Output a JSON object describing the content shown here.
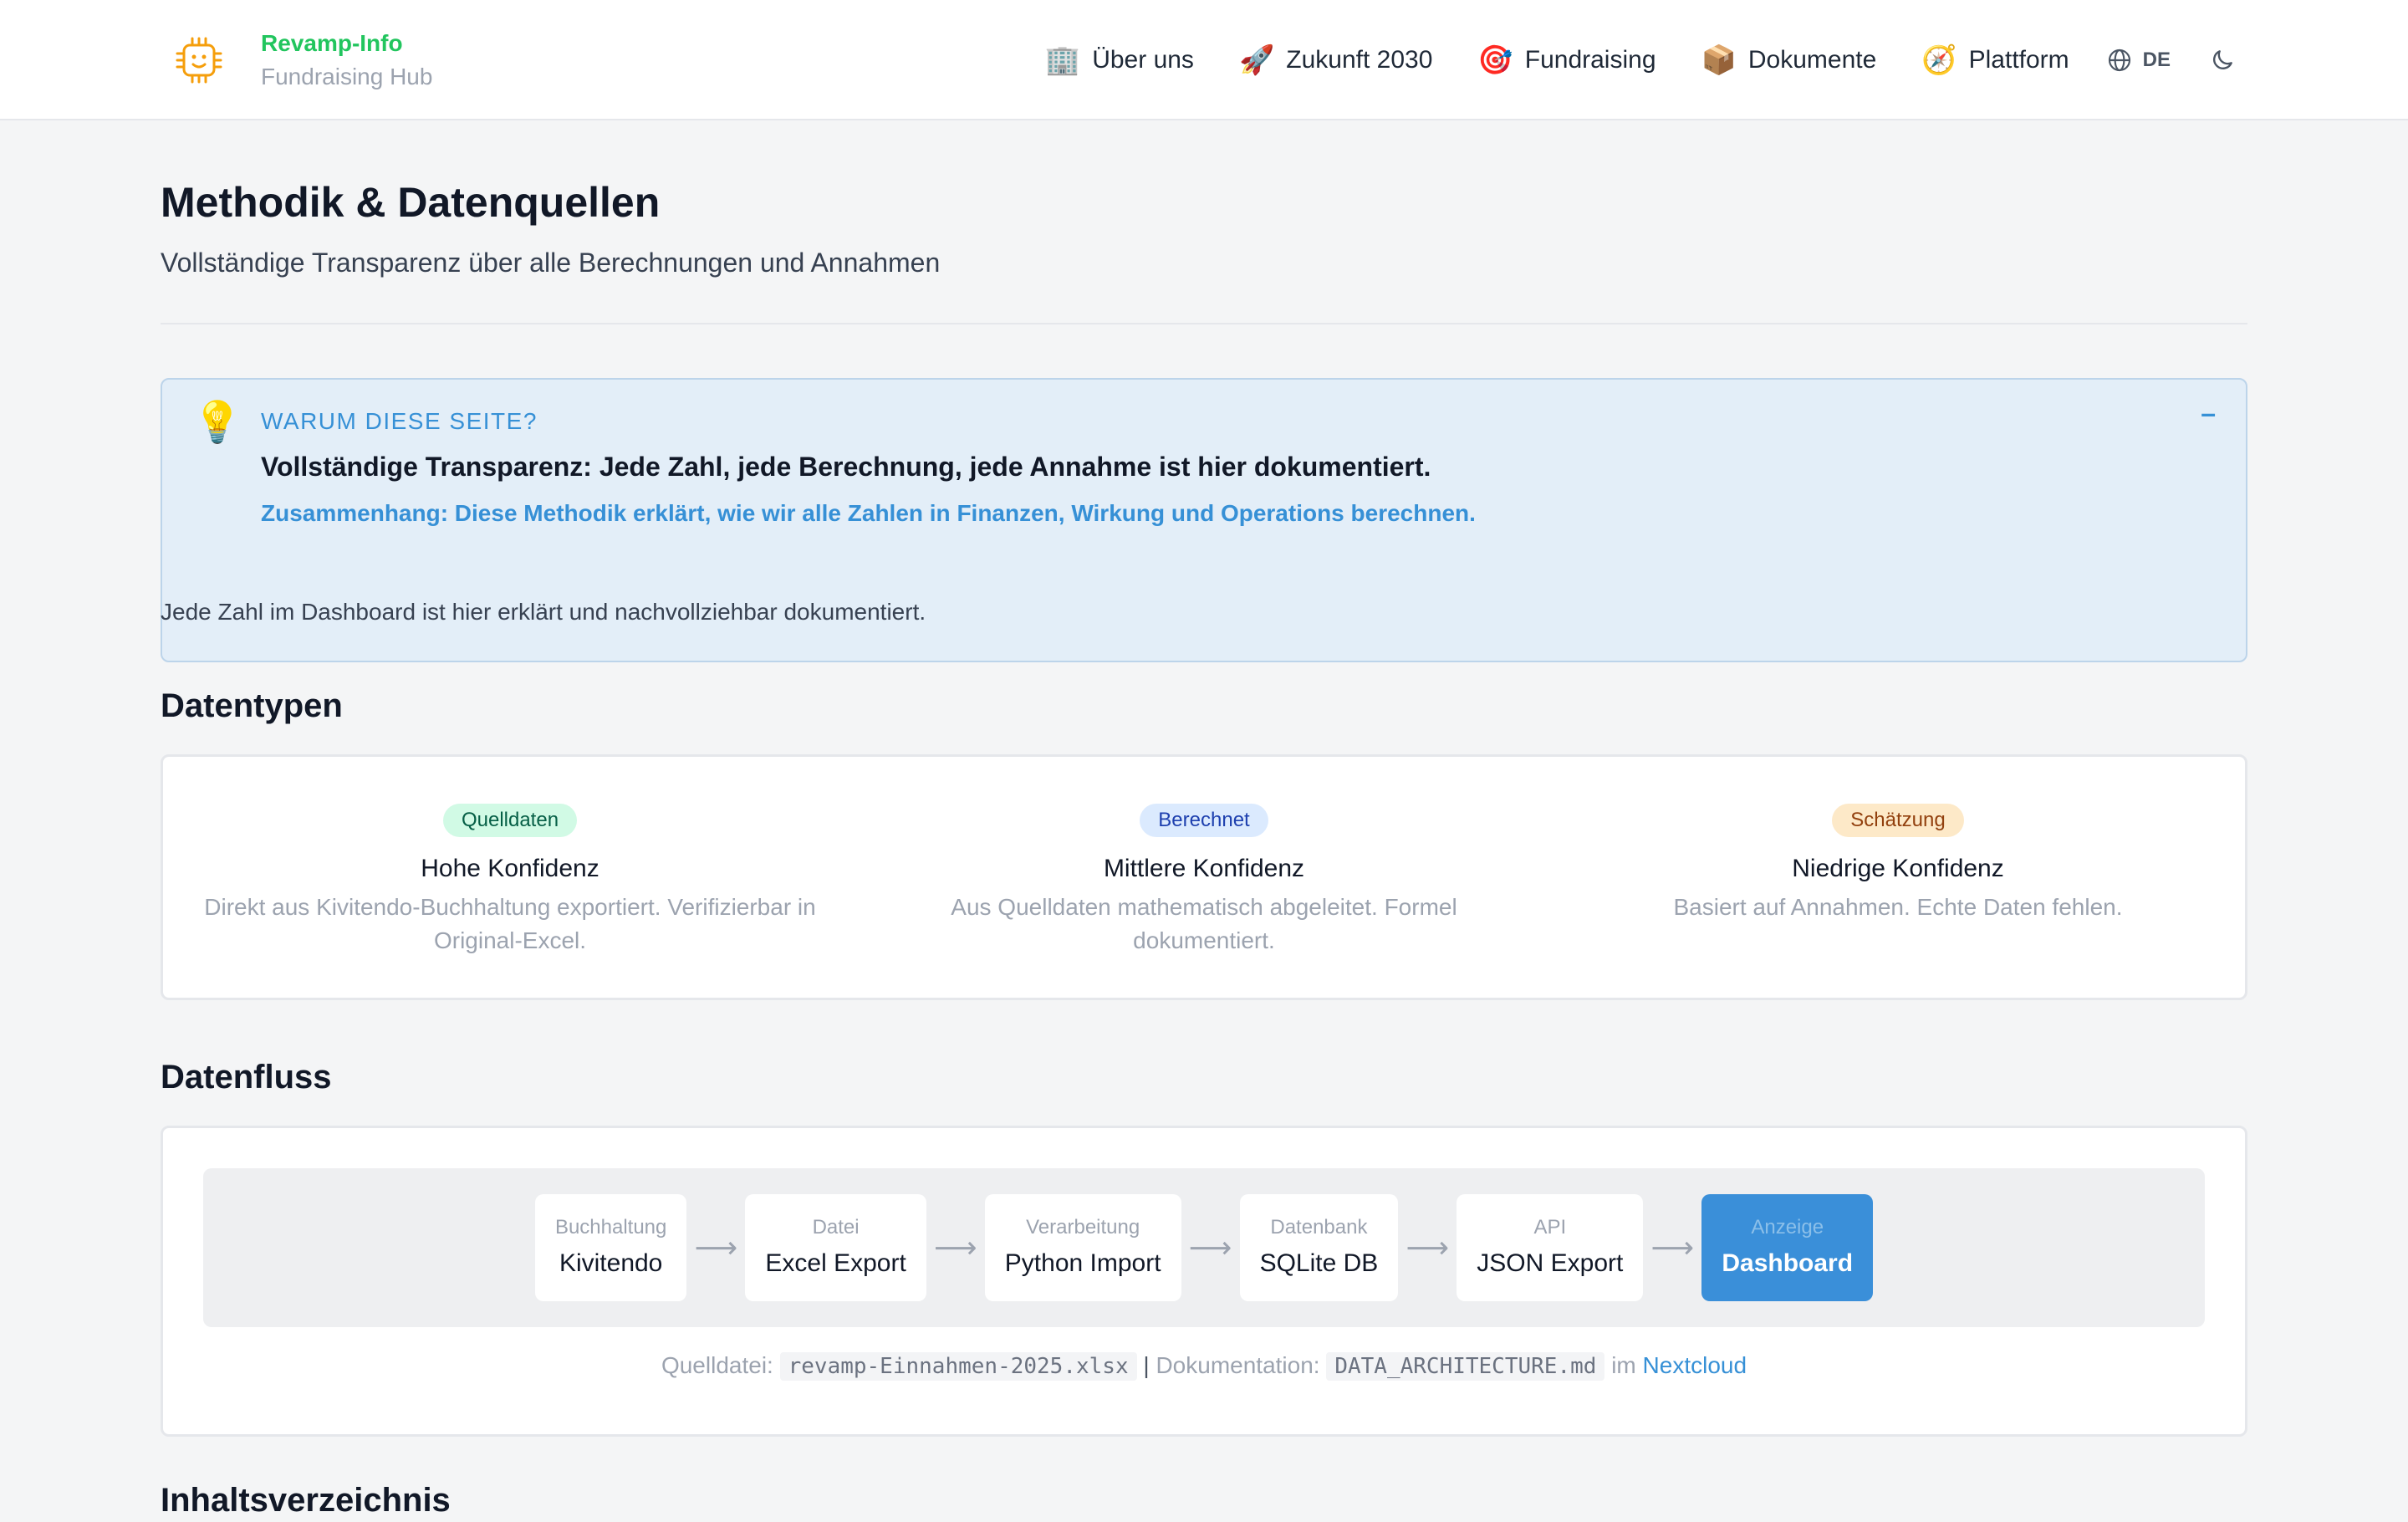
{
  "brand": {
    "title": "Revamp-Info",
    "subtitle": "Fundraising Hub",
    "logo_icon": "robot-chip-icon",
    "accent": "#22c55e"
  },
  "nav": {
    "items": [
      {
        "emoji": "🏢",
        "label": "Über uns"
      },
      {
        "emoji": "🚀",
        "label": "Zukunft 2030"
      },
      {
        "emoji": "🎯",
        "label": "Fundraising"
      },
      {
        "emoji": "📦",
        "label": "Dokumente"
      },
      {
        "emoji": "🧭",
        "label": "Plattform"
      }
    ],
    "language": "DE",
    "language_icon": "globe-icon",
    "theme_icon": "moon-icon"
  },
  "page": {
    "title": "Methodik & Datenquellen",
    "subtitle": "Vollständige Transparenz über alle Berechnungen und Annahmen",
    "lead": "Jede Zahl im Dashboard ist hier erklärt und nachvollziehbar dokumentiert."
  },
  "info": {
    "icon": "💡",
    "kicker": "WARUM DIESE SEITE?",
    "headline": "Vollständige Transparenz: Jede Zahl, jede Berechnung, jede Annahme ist hier dokumentiert.",
    "context": "Zusammenhang: Diese Methodik erklärt, wie wir alle Zahlen in Finanzen, Wirkung und Operations berechnen.",
    "toggle": "–",
    "accent": "#3690d6"
  },
  "datatypes": {
    "heading": "Datentypen",
    "items": [
      {
        "badge": "Quelldaten",
        "title": "Hohe Konfidenz",
        "desc": "Direkt aus Kivitendo-Buchhaltung exportiert. Verifizierbar in Original-Excel."
      },
      {
        "badge": "Berechnet",
        "title": "Mittlere Konfidenz",
        "desc": "Aus Quelldaten mathematisch abgeleitet. Formel dokumentiert."
      },
      {
        "badge": "Schätzung",
        "title": "Niedrige Konfidenz",
        "desc": "Basiert auf Annahmen. Echte Daten fehlen."
      }
    ]
  },
  "dataflow": {
    "heading": "Datenfluss",
    "arrow": "⟶",
    "steps": [
      {
        "label": "Buchhaltung",
        "value": "Kivitendo"
      },
      {
        "label": "Datei",
        "value": "Excel Export"
      },
      {
        "label": "Verarbeitung",
        "value": "Python Import"
      },
      {
        "label": "Datenbank",
        "value": "SQLite DB"
      },
      {
        "label": "API",
        "value": "JSON Export"
      },
      {
        "label": "Anzeige",
        "value": "Dashboard"
      }
    ],
    "footer": {
      "source_label": "Quelldatei:",
      "source_file": "revamp-Einnahmen-2025.xlsx",
      "separator": "|",
      "doc_label": "Dokumentation:",
      "doc_file": "DATA_ARCHITECTURE.md",
      "in_label": "im",
      "link": "Nextcloud"
    },
    "active_color": "#3a8fd9"
  },
  "next_heading": "Inhaltsverzeichnis"
}
